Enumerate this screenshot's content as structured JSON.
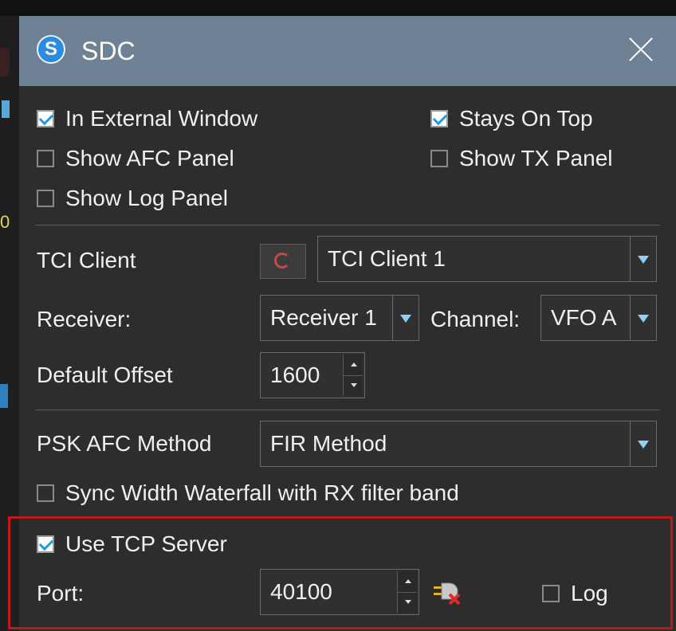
{
  "window": {
    "title": "SDC",
    "logo_letter": "S"
  },
  "display_options": {
    "in_external_window": {
      "label": "In External Window",
      "checked": true
    },
    "stays_on_top": {
      "label": "Stays On Top",
      "checked": true
    },
    "show_afc_panel": {
      "label": "Show AFC Panel",
      "checked": false
    },
    "show_tx_panel": {
      "label": "Show TX Panel",
      "checked": false
    },
    "show_log_panel": {
      "label": "Show Log Panel",
      "checked": false
    }
  },
  "tci": {
    "client_label": "TCI Client",
    "client_value": "TCI Client 1",
    "receiver_label": "Receiver:",
    "receiver_value": "Receiver 1",
    "channel_label": "Channel:",
    "channel_value": "VFO A",
    "offset_label": "Default Offset",
    "offset_value": "1600"
  },
  "psk": {
    "afc_label": "PSK AFC Method",
    "afc_value": "FIR Method",
    "sync_label": "Sync Width Waterfall with RX filter band",
    "sync_checked": false
  },
  "tcp": {
    "use_server_label": "Use TCP Server",
    "use_server_checked": true,
    "port_label": "Port:",
    "port_value": "40100",
    "log_label": "Log",
    "log_checked": false
  },
  "colors": {
    "titlebar": "#6f8195",
    "accent": "#1e9be0",
    "highlight_border": "#c0171b"
  },
  "icons": {
    "app": "sdc-logo-icon",
    "close": "close-icon",
    "refresh": "refresh-icon",
    "connection": "plug-disconnected-icon",
    "dropdown": "chevron-down-icon"
  }
}
